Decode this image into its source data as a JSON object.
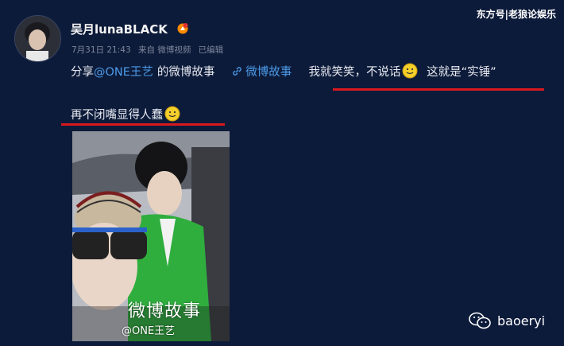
{
  "watermark_top": "东方号|老狼论娱乐",
  "post": {
    "author": "吴月lunaBLACK",
    "date": "7月31日 21:43",
    "source": "来自 微博视频",
    "edited": "已编辑",
    "share_prefix": "分享",
    "mention": "@ONE王艺",
    "share_suffix": "的微博故事",
    "story_link": "微博故事",
    "text1": "我就笑笑，不说话",
    "text2": "这就是“实锤”",
    "text3": "再不闭嘴显得人蠢"
  },
  "video": {
    "caption": "微博故事",
    "handle": "@ONE王艺"
  },
  "watermark_bottom": "baoeryi",
  "colors": {
    "background": "#0d1b3a",
    "link": "#4c9be8",
    "underline": "#d7191f",
    "meta": "#7d879c"
  }
}
